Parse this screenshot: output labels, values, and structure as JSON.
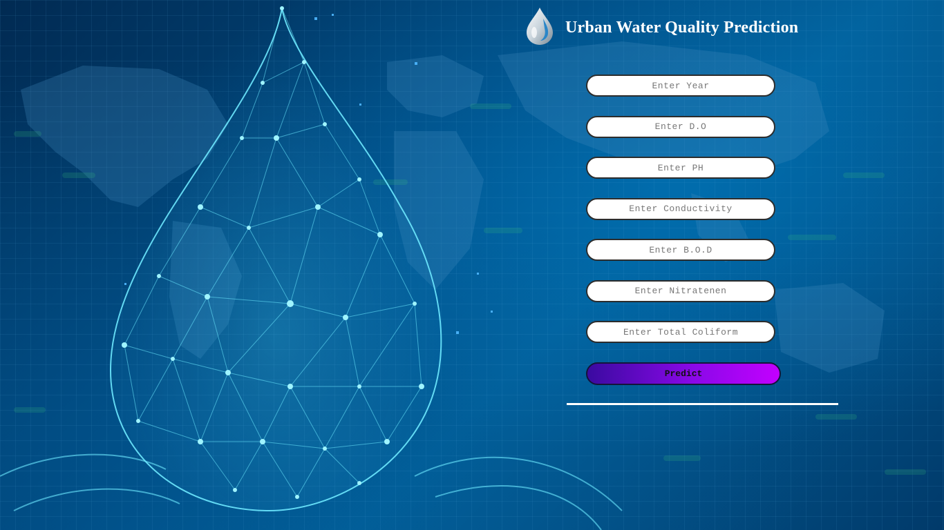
{
  "header": {
    "title": "Urban Water Quality Prediction",
    "logo_icon": "water-drop-icon"
  },
  "form": {
    "fields": [
      {
        "placeholder": "Enter Year",
        "value": ""
      },
      {
        "placeholder": "Enter D.O",
        "value": ""
      },
      {
        "placeholder": "Enter PH",
        "value": ""
      },
      {
        "placeholder": "Enter Conductivity",
        "value": ""
      },
      {
        "placeholder": "Enter B.O.D",
        "value": ""
      },
      {
        "placeholder": "Enter Nitratenen",
        "value": ""
      },
      {
        "placeholder": "Enter Total Coliform",
        "value": ""
      }
    ],
    "submit_label": "Predict"
  },
  "theme": {
    "background": "#014a80",
    "accent_start": "#3a0aa0",
    "accent_end": "#c300ff",
    "glow": "#5fe6ff"
  }
}
